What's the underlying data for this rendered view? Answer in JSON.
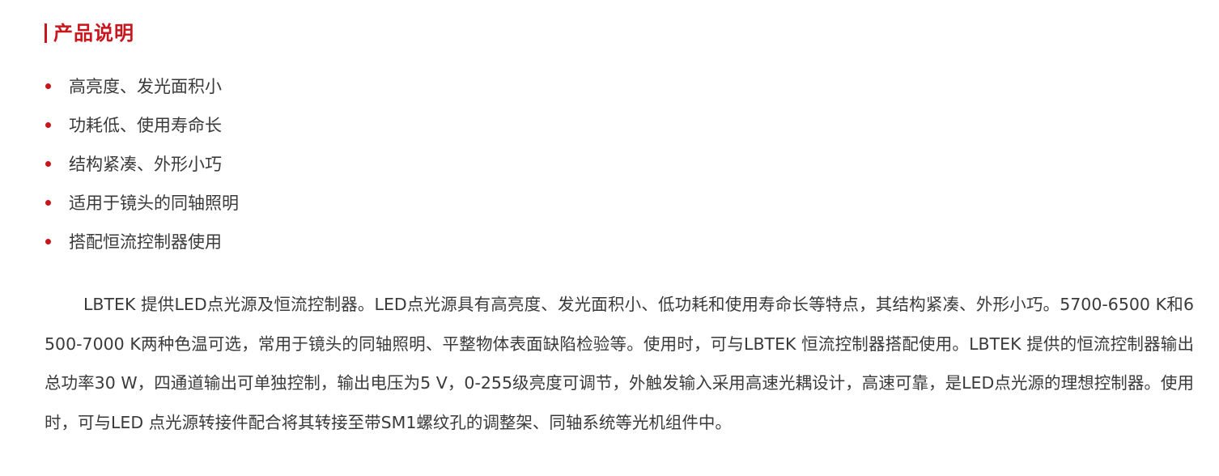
{
  "section": {
    "title": "产品说明"
  },
  "features": [
    "高亮度、发光面积小",
    "功耗低、使用寿命长",
    "结构紧凑、外形小巧",
    "适用于镜头的同轴照明",
    "搭配恒流控制器使用"
  ],
  "description": "LBTEK 提供LED点光源及恒流控制器。LED点光源具有高亮度、发光面积小、低功耗和使用寿命长等特点，其结构紧凑、外形小巧。5700-6500 K和6500-7000 K两种色温可选，常用于镜头的同轴照明、平整物体表面缺陷检验等。使用时，可与LBTEK 恒流控制器搭配使用。LBTEK 提供的恒流控制器输出总功率30 W，四通道输出可单独控制，输出电压为5 V，0-255级亮度可调节，外触发输入采用高速光耦设计，高速可靠，是LED点光源的理想控制器。使用时，可与LED 点光源转接件配合将其转接至带SM1螺纹孔的调整架、同轴系统等光机组件中。",
  "colors": {
    "accent": "#c8161d",
    "text": "#3a3a3a"
  }
}
